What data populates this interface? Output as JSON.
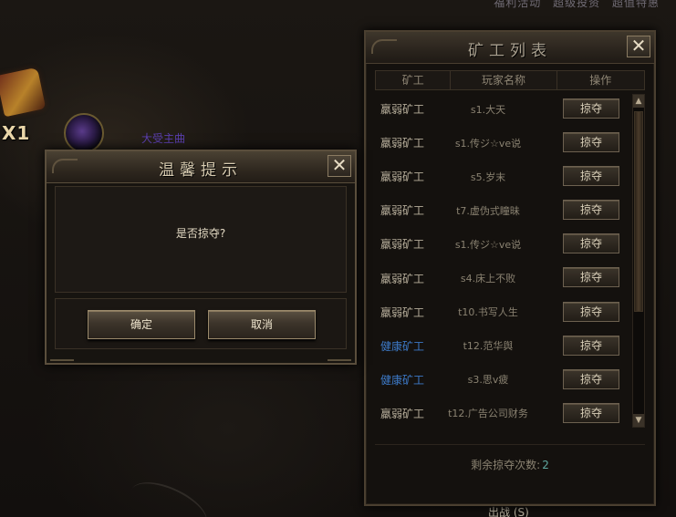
{
  "top_links": [
    "福利活动",
    "超级投资",
    "超值特惠"
  ],
  "background": {
    "reward_count": "X1",
    "gem_label": "大受主曲",
    "bottom_label": "出战 (S)"
  },
  "panel": {
    "title": "矿工列表",
    "close_label": "✕",
    "columns": [
      "矿工",
      "玩家名称",
      "操作"
    ],
    "rows": [
      {
        "type": "羸弱矿工",
        "player": "s1.大天",
        "action": "掠夺",
        "color": "#b7ae9b"
      },
      {
        "type": "羸弱矿工",
        "player": "s1.传ジ☆ve说",
        "action": "掠夺",
        "color": "#b7ae9b"
      },
      {
        "type": "羸弱矿工",
        "player": "s5.岁末",
        "action": "掠夺",
        "color": "#b7ae9b"
      },
      {
        "type": "羸弱矿工",
        "player": "t7.虚伪式瞳昧",
        "action": "掠夺",
        "color": "#b7ae9b"
      },
      {
        "type": "羸弱矿工",
        "player": "s1.传ジ☆ve说",
        "action": "掠夺",
        "color": "#b7ae9b"
      },
      {
        "type": "羸弱矿工",
        "player": "s4.床上不败",
        "action": "掠夺",
        "color": "#b7ae9b"
      },
      {
        "type": "羸弱矿工",
        "player": "t10.书写人生",
        "action": "掠夺",
        "color": "#b7ae9b"
      },
      {
        "type": "健康矿工",
        "player": "t12.范华舆",
        "action": "掠夺",
        "color": "#3d7ac8"
      },
      {
        "type": "健康矿工",
        "player": "s3.思v疲",
        "action": "掠夺",
        "color": "#3d7ac8"
      },
      {
        "type": "羸弱矿工",
        "player": "t12.广告公司财务",
        "action": "掠夺",
        "color": "#b7ae9b"
      }
    ],
    "remaining_label": "剩余掠夺次数:",
    "remaining_value": "2"
  },
  "dialog": {
    "title": "温馨提示",
    "close_label": "✕",
    "message": "是否掠夺?",
    "confirm_label": "确定",
    "cancel_label": "取消"
  },
  "icons": {
    "scroll_up": "▲",
    "scroll_down": "▼"
  }
}
